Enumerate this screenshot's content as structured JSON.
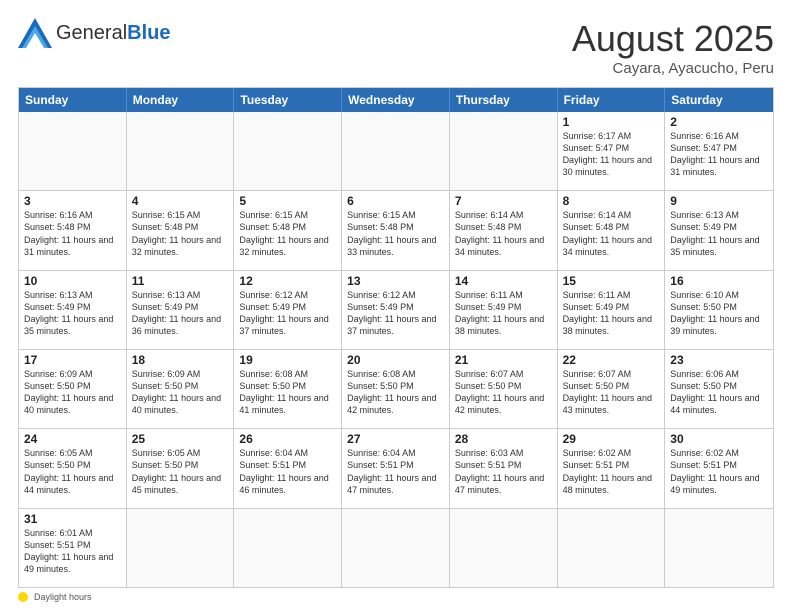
{
  "header": {
    "logo_general": "General",
    "logo_blue": "Blue",
    "month_title": "August 2025",
    "location": "Cayara, Ayacucho, Peru"
  },
  "weekdays": [
    "Sunday",
    "Monday",
    "Tuesday",
    "Wednesday",
    "Thursday",
    "Friday",
    "Saturday"
  ],
  "rows": [
    [
      {
        "day": "",
        "sunrise": "",
        "sunset": "",
        "daylight": ""
      },
      {
        "day": "",
        "sunrise": "",
        "sunset": "",
        "daylight": ""
      },
      {
        "day": "",
        "sunrise": "",
        "sunset": "",
        "daylight": ""
      },
      {
        "day": "",
        "sunrise": "",
        "sunset": "",
        "daylight": ""
      },
      {
        "day": "",
        "sunrise": "",
        "sunset": "",
        "daylight": ""
      },
      {
        "day": "1",
        "sunrise": "Sunrise: 6:17 AM",
        "sunset": "Sunset: 5:47 PM",
        "daylight": "Daylight: 11 hours and 30 minutes."
      },
      {
        "day": "2",
        "sunrise": "Sunrise: 6:16 AM",
        "sunset": "Sunset: 5:47 PM",
        "daylight": "Daylight: 11 hours and 31 minutes."
      }
    ],
    [
      {
        "day": "3",
        "sunrise": "Sunrise: 6:16 AM",
        "sunset": "Sunset: 5:48 PM",
        "daylight": "Daylight: 11 hours and 31 minutes."
      },
      {
        "day": "4",
        "sunrise": "Sunrise: 6:15 AM",
        "sunset": "Sunset: 5:48 PM",
        "daylight": "Daylight: 11 hours and 32 minutes."
      },
      {
        "day": "5",
        "sunrise": "Sunrise: 6:15 AM",
        "sunset": "Sunset: 5:48 PM",
        "daylight": "Daylight: 11 hours and 32 minutes."
      },
      {
        "day": "6",
        "sunrise": "Sunrise: 6:15 AM",
        "sunset": "Sunset: 5:48 PM",
        "daylight": "Daylight: 11 hours and 33 minutes."
      },
      {
        "day": "7",
        "sunrise": "Sunrise: 6:14 AM",
        "sunset": "Sunset: 5:48 PM",
        "daylight": "Daylight: 11 hours and 34 minutes."
      },
      {
        "day": "8",
        "sunrise": "Sunrise: 6:14 AM",
        "sunset": "Sunset: 5:48 PM",
        "daylight": "Daylight: 11 hours and 34 minutes."
      },
      {
        "day": "9",
        "sunrise": "Sunrise: 6:13 AM",
        "sunset": "Sunset: 5:49 PM",
        "daylight": "Daylight: 11 hours and 35 minutes."
      }
    ],
    [
      {
        "day": "10",
        "sunrise": "Sunrise: 6:13 AM",
        "sunset": "Sunset: 5:49 PM",
        "daylight": "Daylight: 11 hours and 35 minutes."
      },
      {
        "day": "11",
        "sunrise": "Sunrise: 6:13 AM",
        "sunset": "Sunset: 5:49 PM",
        "daylight": "Daylight: 11 hours and 36 minutes."
      },
      {
        "day": "12",
        "sunrise": "Sunrise: 6:12 AM",
        "sunset": "Sunset: 5:49 PM",
        "daylight": "Daylight: 11 hours and 37 minutes."
      },
      {
        "day": "13",
        "sunrise": "Sunrise: 6:12 AM",
        "sunset": "Sunset: 5:49 PM",
        "daylight": "Daylight: 11 hours and 37 minutes."
      },
      {
        "day": "14",
        "sunrise": "Sunrise: 6:11 AM",
        "sunset": "Sunset: 5:49 PM",
        "daylight": "Daylight: 11 hours and 38 minutes."
      },
      {
        "day": "15",
        "sunrise": "Sunrise: 6:11 AM",
        "sunset": "Sunset: 5:49 PM",
        "daylight": "Daylight: 11 hours and 38 minutes."
      },
      {
        "day": "16",
        "sunrise": "Sunrise: 6:10 AM",
        "sunset": "Sunset: 5:50 PM",
        "daylight": "Daylight: 11 hours and 39 minutes."
      }
    ],
    [
      {
        "day": "17",
        "sunrise": "Sunrise: 6:09 AM",
        "sunset": "Sunset: 5:50 PM",
        "daylight": "Daylight: 11 hours and 40 minutes."
      },
      {
        "day": "18",
        "sunrise": "Sunrise: 6:09 AM",
        "sunset": "Sunset: 5:50 PM",
        "daylight": "Daylight: 11 hours and 40 minutes."
      },
      {
        "day": "19",
        "sunrise": "Sunrise: 6:08 AM",
        "sunset": "Sunset: 5:50 PM",
        "daylight": "Daylight: 11 hours and 41 minutes."
      },
      {
        "day": "20",
        "sunrise": "Sunrise: 6:08 AM",
        "sunset": "Sunset: 5:50 PM",
        "daylight": "Daylight: 11 hours and 42 minutes."
      },
      {
        "day": "21",
        "sunrise": "Sunrise: 6:07 AM",
        "sunset": "Sunset: 5:50 PM",
        "daylight": "Daylight: 11 hours and 42 minutes."
      },
      {
        "day": "22",
        "sunrise": "Sunrise: 6:07 AM",
        "sunset": "Sunset: 5:50 PM",
        "daylight": "Daylight: 11 hours and 43 minutes."
      },
      {
        "day": "23",
        "sunrise": "Sunrise: 6:06 AM",
        "sunset": "Sunset: 5:50 PM",
        "daylight": "Daylight: 11 hours and 44 minutes."
      }
    ],
    [
      {
        "day": "24",
        "sunrise": "Sunrise: 6:05 AM",
        "sunset": "Sunset: 5:50 PM",
        "daylight": "Daylight: 11 hours and 44 minutes."
      },
      {
        "day": "25",
        "sunrise": "Sunrise: 6:05 AM",
        "sunset": "Sunset: 5:50 PM",
        "daylight": "Daylight: 11 hours and 45 minutes."
      },
      {
        "day": "26",
        "sunrise": "Sunrise: 6:04 AM",
        "sunset": "Sunset: 5:51 PM",
        "daylight": "Daylight: 11 hours and 46 minutes."
      },
      {
        "day": "27",
        "sunrise": "Sunrise: 6:04 AM",
        "sunset": "Sunset: 5:51 PM",
        "daylight": "Daylight: 11 hours and 47 minutes."
      },
      {
        "day": "28",
        "sunrise": "Sunrise: 6:03 AM",
        "sunset": "Sunset: 5:51 PM",
        "daylight": "Daylight: 11 hours and 47 minutes."
      },
      {
        "day": "29",
        "sunrise": "Sunrise: 6:02 AM",
        "sunset": "Sunset: 5:51 PM",
        "daylight": "Daylight: 11 hours and 48 minutes."
      },
      {
        "day": "30",
        "sunrise": "Sunrise: 6:02 AM",
        "sunset": "Sunset: 5:51 PM",
        "daylight": "Daylight: 11 hours and 49 minutes."
      }
    ],
    [
      {
        "day": "31",
        "sunrise": "Sunrise: 6:01 AM",
        "sunset": "Sunset: 5:51 PM",
        "daylight": "Daylight: 11 hours and 49 minutes."
      },
      {
        "day": "",
        "sunrise": "",
        "sunset": "",
        "daylight": ""
      },
      {
        "day": "",
        "sunrise": "",
        "sunset": "",
        "daylight": ""
      },
      {
        "day": "",
        "sunrise": "",
        "sunset": "",
        "daylight": ""
      },
      {
        "day": "",
        "sunrise": "",
        "sunset": "",
        "daylight": ""
      },
      {
        "day": "",
        "sunrise": "",
        "sunset": "",
        "daylight": ""
      },
      {
        "day": "",
        "sunrise": "",
        "sunset": "",
        "daylight": ""
      }
    ]
  ],
  "footer": {
    "daylight_label": "Daylight hours"
  }
}
